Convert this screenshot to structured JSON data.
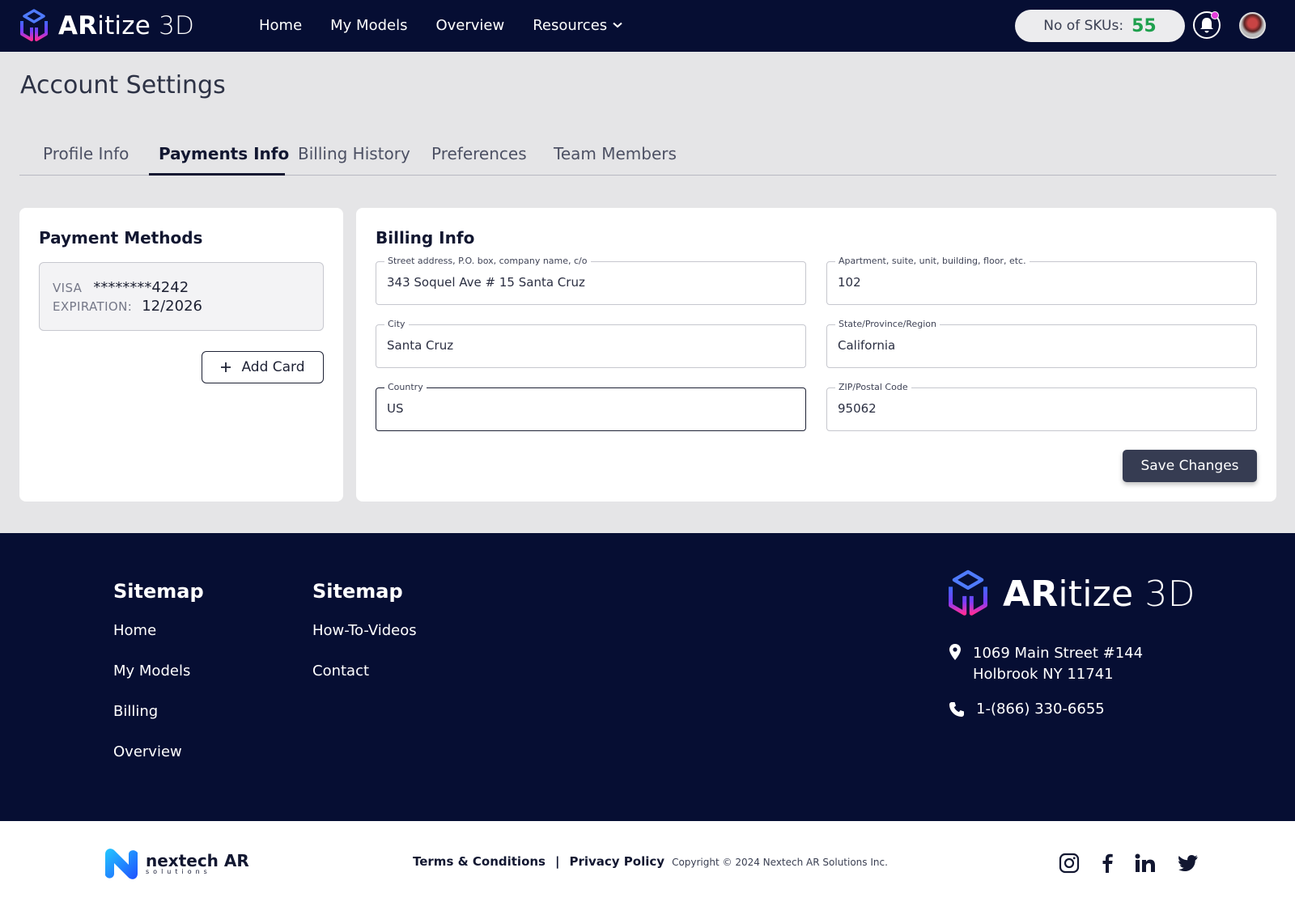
{
  "header": {
    "logo_bold": "AR",
    "logo_rest": "itize",
    "logo_3d": "3D",
    "nav": [
      {
        "label": "Home"
      },
      {
        "label": "My Models"
      },
      {
        "label": "Overview"
      },
      {
        "label": "Resources",
        "icon": "chevron-down-icon"
      }
    ],
    "sku_label": "No of SKUs:",
    "sku_value": "55"
  },
  "page": {
    "title": "Account Settings",
    "tabs": [
      {
        "label": "Profile Info"
      },
      {
        "label": "Payments Info",
        "active": true
      },
      {
        "label": "Billing History"
      },
      {
        "label": "Preferences"
      },
      {
        "label": "Team Members"
      }
    ]
  },
  "payment_methods": {
    "title": "Payment Methods",
    "card_brand": "VISA",
    "card_number": "********4242",
    "expiration_label": "EXPIRATION:",
    "expiration_value": "12/2026",
    "add_card_label": "Add Card"
  },
  "billing_info": {
    "title": "Billing Info",
    "fields": {
      "street": {
        "label": "Street address, P.O. box, company name, c/o",
        "value": "343 Soquel Ave # 15 Santa Cruz"
      },
      "apartment": {
        "label": "Apartment, suite, unit, building, floor, etc.",
        "value": "102"
      },
      "city": {
        "label": "City",
        "value": "Santa Cruz"
      },
      "state": {
        "label": "State/Province/Region",
        "value": "California"
      },
      "country": {
        "label": "Country",
        "value": "US"
      },
      "zip": {
        "label": "ZIP/Postal Code",
        "value": "95062"
      }
    },
    "save_label": "Save Changes"
  },
  "footer": {
    "col1": {
      "heading": "Sitemap",
      "links": [
        "Home",
        "My Models",
        "Billing",
        "Overview"
      ]
    },
    "col2": {
      "heading": "Sitemap",
      "links": [
        "How-To-Videos",
        "Contact"
      ]
    },
    "address_line1": "1069 Main Street #144",
    "address_line2": "Holbrook NY 11741",
    "phone": "1-(866) 330-6655"
  },
  "bottom": {
    "nextech_name": "nextech AR",
    "nextech_sub": "solutions",
    "terms": "Terms & Conditions",
    "separator": "|",
    "privacy": "Privacy Policy",
    "copyright": "Copyright © 2024 Nextech AR Solutions Inc.",
    "social_icons": [
      "instagram-icon",
      "facebook-icon",
      "linkedin-icon",
      "twitter-icon"
    ]
  },
  "colors": {
    "navy": "#060e33",
    "sku_green": "#1fa04e",
    "button_dark": "#363c52",
    "notification_dot": "#e23dd9"
  }
}
